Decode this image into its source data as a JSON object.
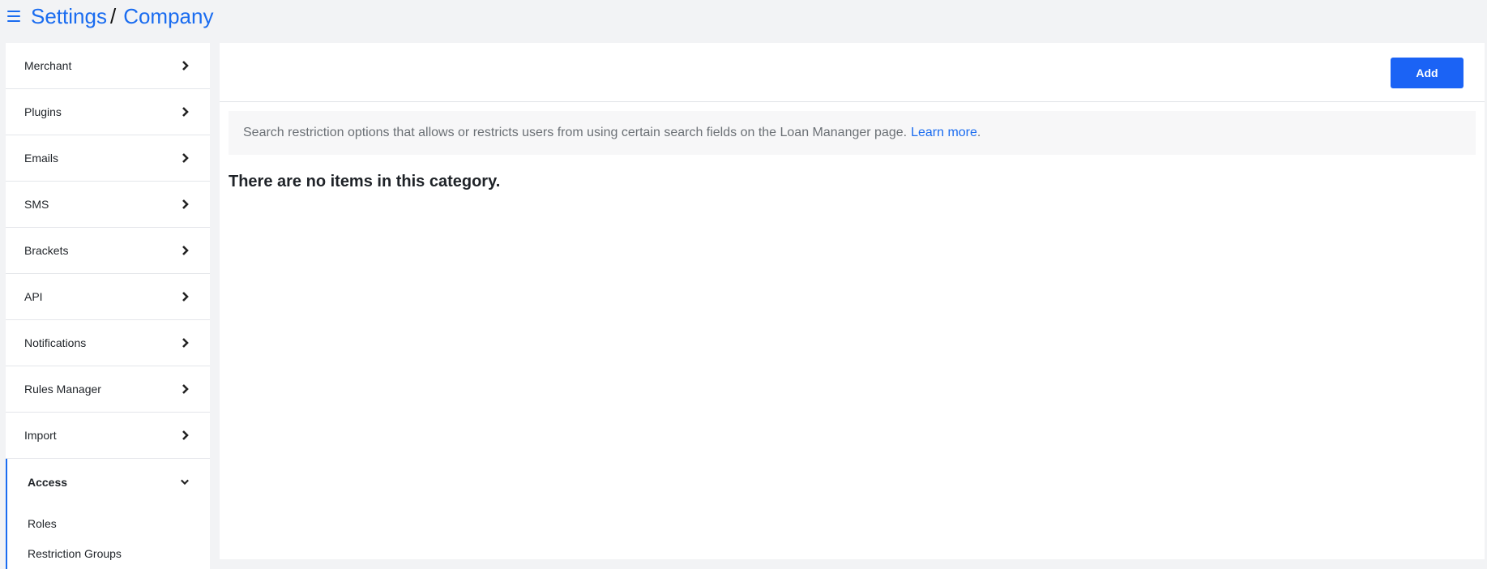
{
  "header": {
    "breadcrumb_root": "Settings",
    "breadcrumb_separator": "/",
    "breadcrumb_current": "Company"
  },
  "sidebar": {
    "items": [
      {
        "label": "Merchant",
        "icon": "chevron-right-icon"
      },
      {
        "label": "Plugins",
        "icon": "chevron-right-icon"
      },
      {
        "label": "Emails",
        "icon": "chevron-right-icon"
      },
      {
        "label": "SMS",
        "icon": "chevron-right-icon"
      },
      {
        "label": "Brackets",
        "icon": "chevron-right-icon"
      },
      {
        "label": "API",
        "icon": "chevron-right-icon"
      },
      {
        "label": "Notifications",
        "icon": "chevron-right-icon"
      },
      {
        "label": "Rules Manager",
        "icon": "chevron-right-icon"
      },
      {
        "label": "Import",
        "icon": "chevron-right-icon"
      }
    ],
    "active_item": {
      "label": "Access",
      "icon": "chevron-down-icon",
      "sub_items": [
        "Roles",
        "Restriction Groups"
      ]
    }
  },
  "main": {
    "add_label": "Add",
    "info_text": "Search restriction options that allows or restricts users from using certain search fields on the Loan Mananger page.",
    "info_link": "Learn more",
    "info_period": ".",
    "empty_message": "There are no items in this category."
  },
  "colors": {
    "accent": "#1a6cf0",
    "button": "#1b63f5",
    "background": "#f2f3f5"
  }
}
